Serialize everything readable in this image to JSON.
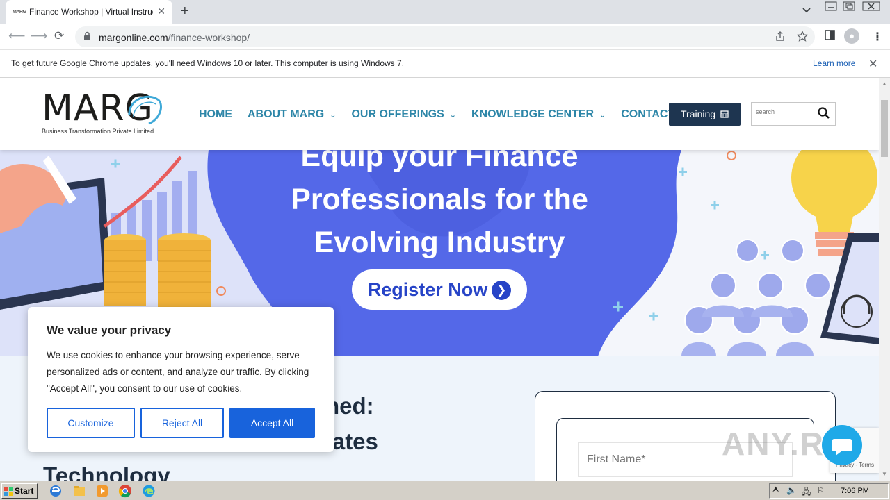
{
  "browser": {
    "tab_title": "Finance Workshop | Virtual Instructor",
    "favicon_text": "MARG",
    "new_tab_symbol": "+",
    "url_host": "margonline.com",
    "url_path": "/finance-workshop/",
    "infobar_message": "To get future Google Chrome updates, you'll need Windows 10 or later. This computer is using Windows 7.",
    "infobar_link": "Learn more"
  },
  "site": {
    "logo_text": "MARG",
    "logo_tagline": "Business Transformation Private Limited",
    "nav": [
      {
        "label": "HOME",
        "dropdown": false
      },
      {
        "label": "ABOUT MARG",
        "dropdown": true
      },
      {
        "label": "OUR OFFERINGS",
        "dropdown": true
      },
      {
        "label": "KNOWLEDGE CENTER",
        "dropdown": true
      },
      {
        "label": "CONTACT US",
        "dropdown": false
      }
    ],
    "training_button": "Training",
    "search_placeholder": "search"
  },
  "hero": {
    "line1": "Equip your Finance",
    "line2": "Professionals for the",
    "line3": "Evolving Industry",
    "register_button": "Register Now"
  },
  "content": {
    "heading_line1": "hed:",
    "heading_line2": "rates",
    "heading_line3": "Technology",
    "first_name_placeholder": "First Name*",
    "recaptcha_text": "Privacy - Terms",
    "watermark": "ANY.RUN"
  },
  "cookie": {
    "title": "We value your privacy",
    "body": "We use cookies to enhance your browsing experience, serve personalized ads or content, and analyze our traffic. By clicking \"Accept All\", you consent to our use of cookies.",
    "customize": "Customize",
    "reject": "Reject All",
    "accept": "Accept All"
  },
  "taskbar": {
    "start": "Start",
    "clock": "7:06 PM"
  },
  "colors": {
    "nav_text": "#2d86a8",
    "hero_blue": "#5468e8",
    "dark_navy": "#1e3550",
    "cookie_blue": "#1863dc"
  }
}
